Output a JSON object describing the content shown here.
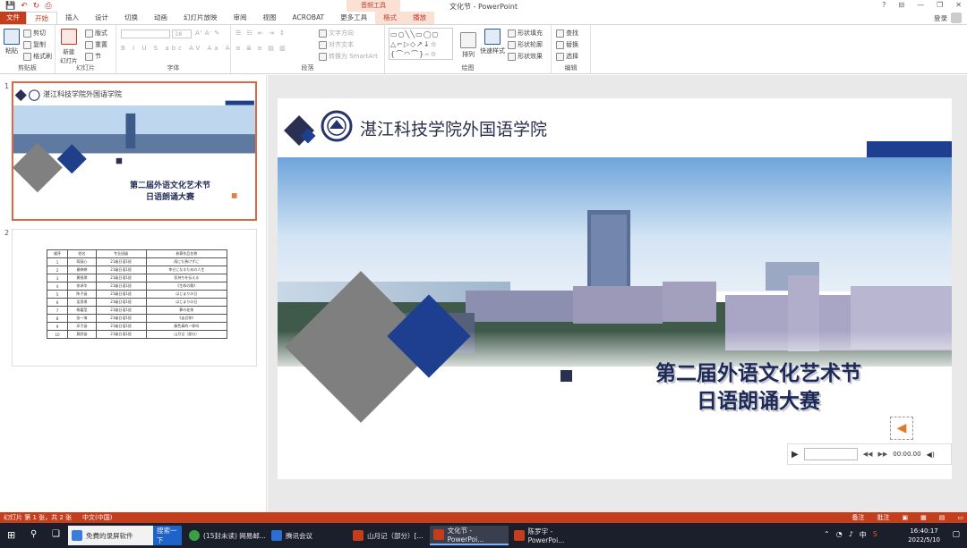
{
  "window": {
    "title": "文化节 - PowerPoint",
    "context_group": "音频工具",
    "controls": [
      "?",
      "⊟",
      "—",
      "❐",
      "✕"
    ]
  },
  "qat": [
    "💾",
    "↶",
    "↻",
    "⎙"
  ],
  "tabs": [
    {
      "label": "文件",
      "type": "file"
    },
    {
      "label": "开始",
      "type": "active"
    },
    {
      "label": "插入"
    },
    {
      "label": "设计"
    },
    {
      "label": "切换"
    },
    {
      "label": "动画"
    },
    {
      "label": "幻灯片放映"
    },
    {
      "label": "审阅"
    },
    {
      "label": "视图"
    },
    {
      "label": "ACROBAT"
    },
    {
      "label": "更多工具"
    },
    {
      "label": "格式",
      "type": "ctx"
    },
    {
      "label": "播放",
      "type": "ctx"
    }
  ],
  "signin": "登录",
  "ribbon": {
    "clipboard": {
      "paste": "粘贴",
      "cut": "剪切",
      "copy": "复制",
      "format_painter": "格式刷",
      "label": "剪贴板"
    },
    "slides": {
      "new_slide": "新建\n幻灯片",
      "layout": "版式",
      "reset": "重置",
      "section": "节",
      "label": "幻灯片"
    },
    "font": {
      "size": "18",
      "label": "字体"
    },
    "paragraph": {
      "text_direction": "文字方向",
      "align_text": "对齐文本",
      "smartart": "转换为 SmartArt",
      "label": "段落"
    },
    "drawing": {
      "arrange": "排列",
      "quick_styles": "快速样式",
      "fill": "形状填充",
      "outline": "形状轮廓",
      "effects": "形状效果",
      "label": "绘图"
    },
    "editing": {
      "find": "查找",
      "replace": "替换",
      "select": "选择",
      "label": "编辑"
    }
  },
  "slide1": {
    "number": "1",
    "org": "湛江科技学院外国语学院",
    "title_line1": "第二届外语文化艺术节",
    "title_line2": "日语朗诵大赛"
  },
  "slide2": {
    "number": "2",
    "table": {
      "headers": [
        "顺序",
        "姓名",
        "专业班级",
        "参赛作品名称"
      ],
      "rows": [
        [
          "1",
          "蒋丽心",
          "21级日语1班",
          "雨にも負けずに"
        ],
        [
          "2",
          "谢婷婷",
          "21级日语1班",
          "幸せになるための人生"
        ],
        [
          "3",
          "黄锐琪",
          "21级日语1班",
          "気持ちを伝える"
        ],
        [
          "4",
          "徐泽华",
          "21级日语1班",
          "《生命の歌》"
        ],
        [
          "5",
          "陈子涵",
          "21级日语1班",
          "はじまりの日"
        ],
        [
          "6",
          "吴思琪",
          "21级日语1班",
          "はじまりの日"
        ],
        [
          "7",
          "杨嘉莹",
          "21级日语1班",
          "夢の花束"
        ],
        [
          "8",
          "张一海",
          "21级日语1班",
          "《走近你》"
        ],
        [
          "9",
          "邓子涵",
          "21级日语1班",
          "春色真的一样吗"
        ],
        [
          "10",
          "莫舒涵",
          "21级日语1班",
          "山月记（部分）"
        ]
      ]
    }
  },
  "audio": {
    "time": "00:00.00"
  },
  "status": {
    "slide_info": "幻灯片 第 1 张，共 2 张",
    "language": "中文(中国)",
    "notes": "备注",
    "comments": "批注"
  },
  "taskbar": {
    "items": [
      {
        "label": "免費的录屏软件",
        "color": "#3b7dd8"
      },
      {
        "label": "搜索一下",
        "color": "#1e63c8"
      },
      {
        "label": "(15封未读) 网易邮...",
        "color": "#3aa043"
      },
      {
        "label": "腾讯会议",
        "color": "#2a6fd6"
      },
      {
        "label": "山月记（部分）[...",
        "color": "#c43e1c"
      },
      {
        "label": "文化节 - PowerPoi...",
        "color": "#c43e1c"
      },
      {
        "label": "陈罗宇 - PowerPoi...",
        "color": "#c43e1c"
      }
    ],
    "time": "16:40:17",
    "date": "2022/5/10",
    "ime": "中"
  }
}
